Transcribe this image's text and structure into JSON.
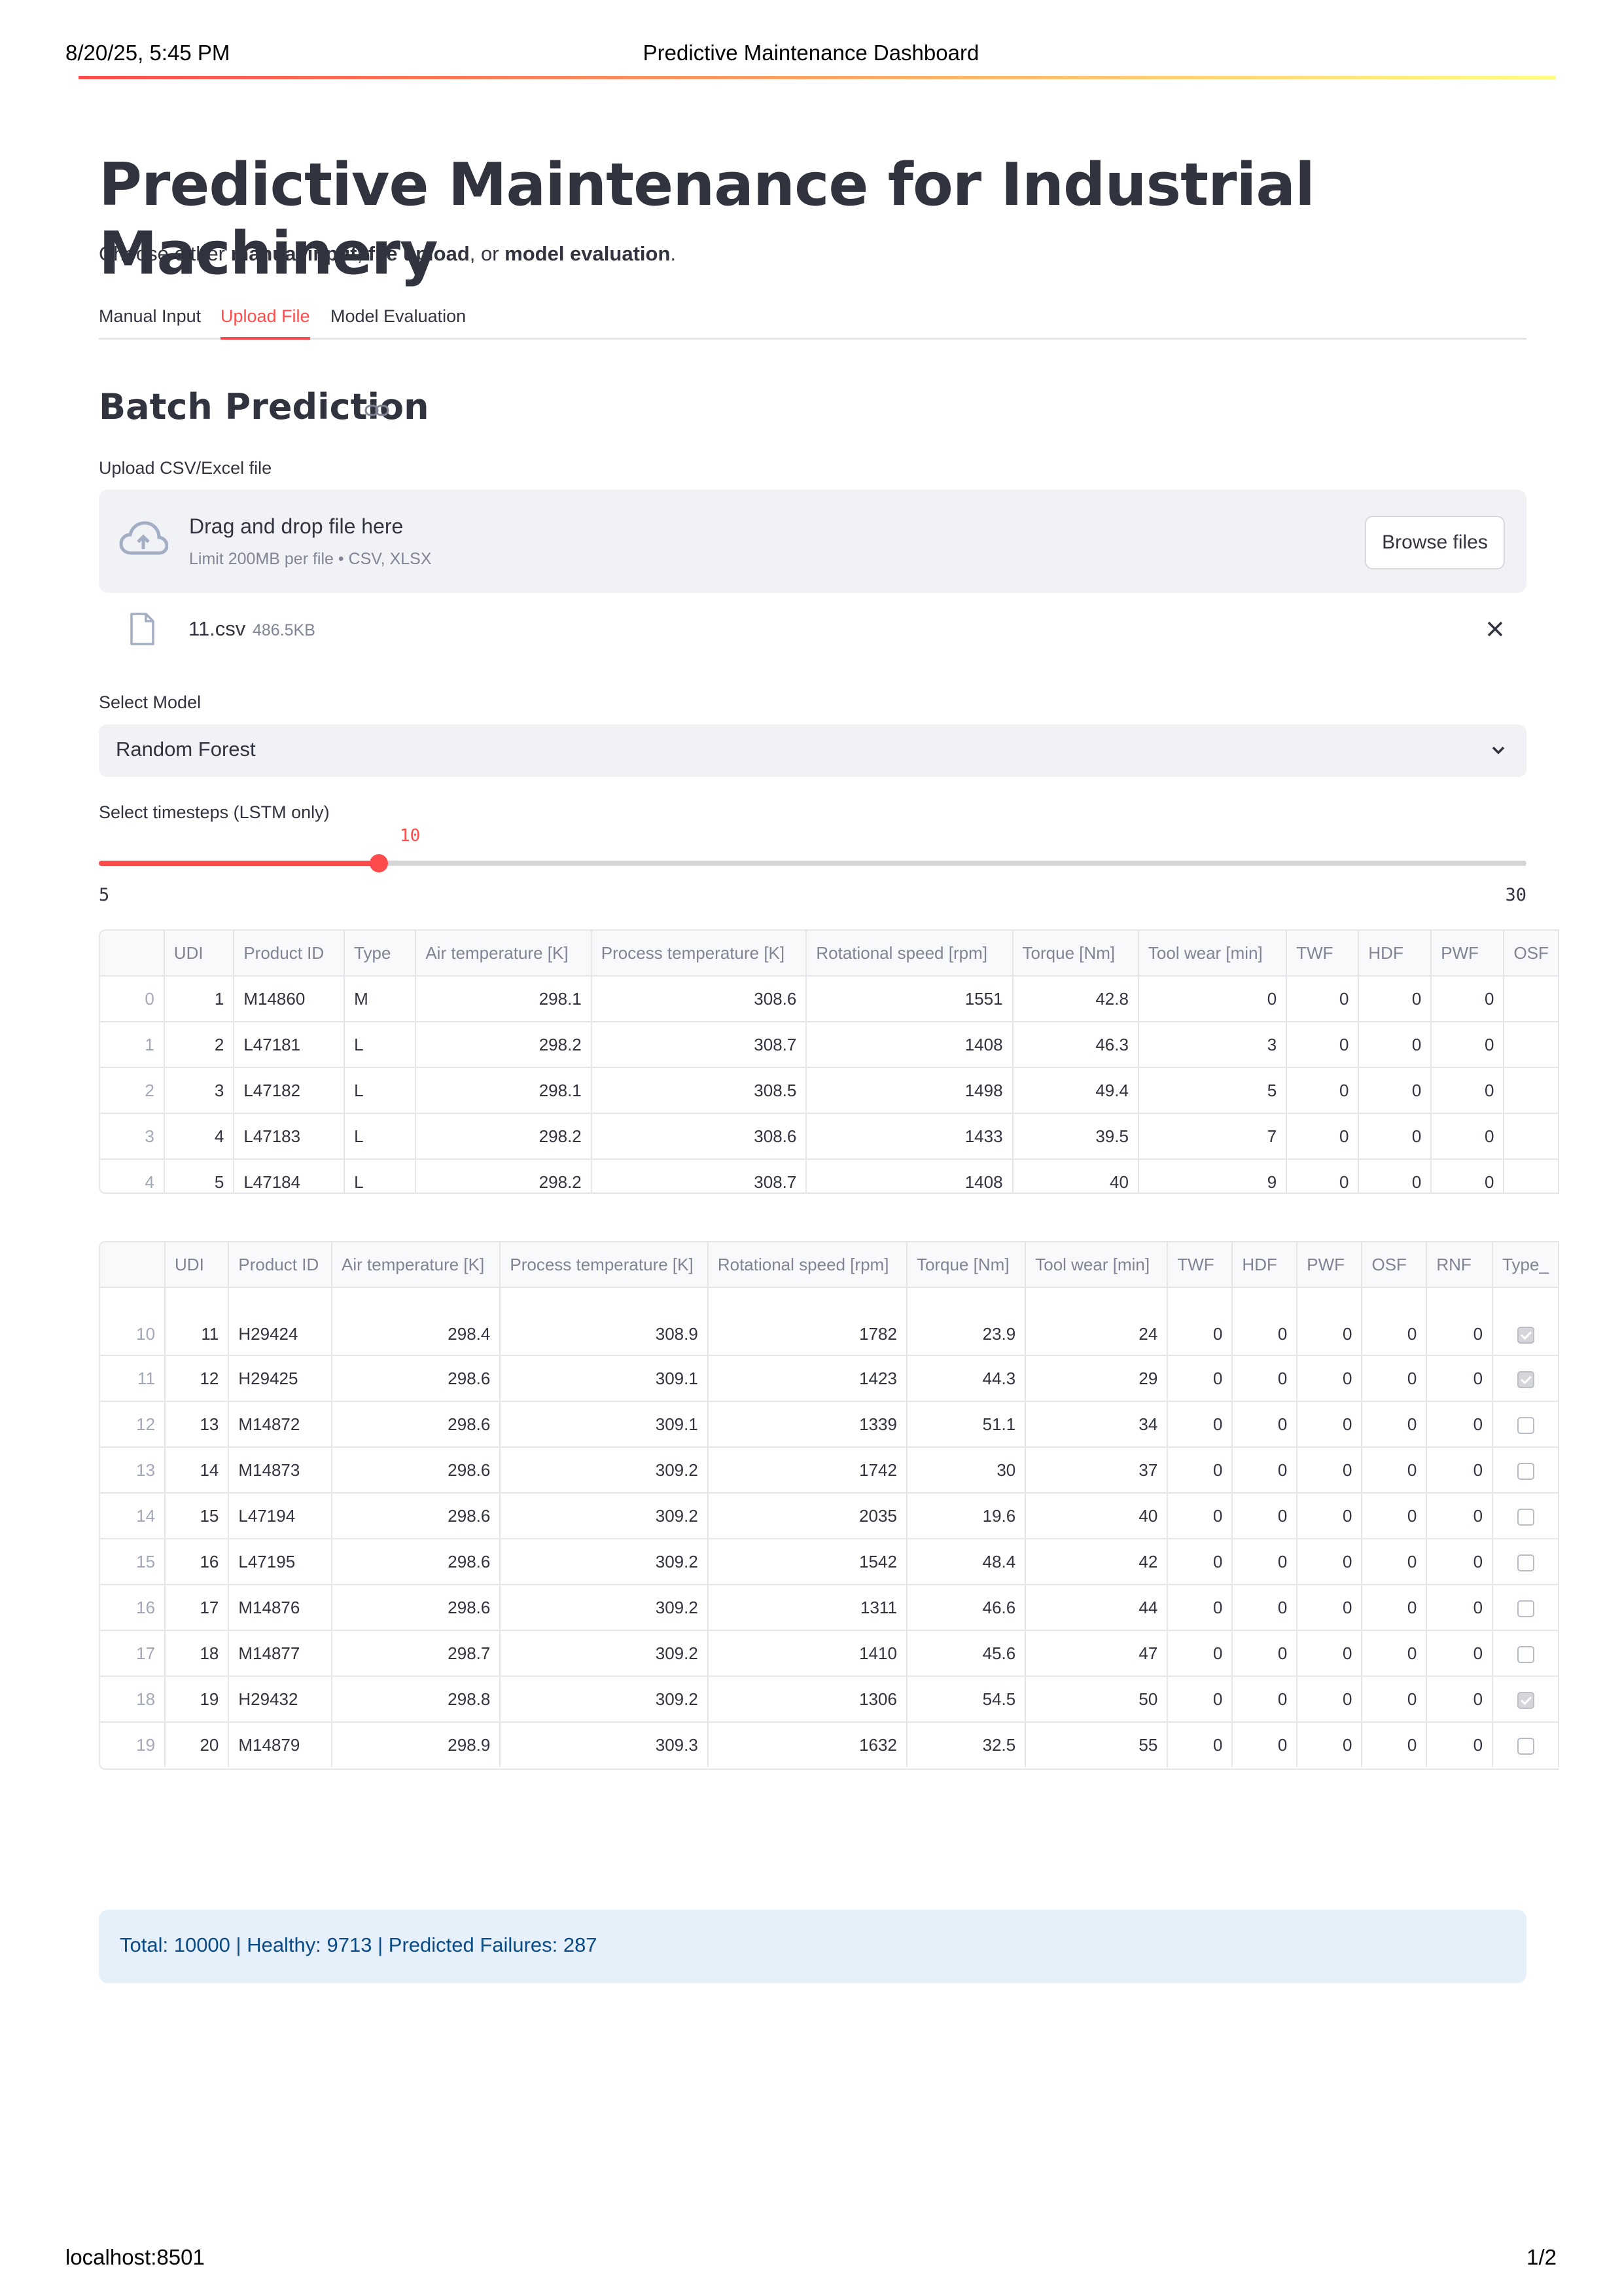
{
  "print": {
    "date": "8/20/25, 5:45 PM",
    "title": "Predictive Maintenance Dashboard",
    "url": "localhost:8501",
    "page": "1/2"
  },
  "app": {
    "title": "Predictive Maintenance for Industrial Machinery",
    "subtitle_parts": [
      "Choose either ",
      "manual input",
      ", ",
      "file upload",
      ", or ",
      "model evaluation",
      "."
    ]
  },
  "tabs": [
    {
      "label": "Manual Input",
      "active": false
    },
    {
      "label": "Upload File",
      "active": true
    },
    {
      "label": "Model Evaluation",
      "active": false
    }
  ],
  "section": {
    "title": "Batch Prediction",
    "link_icon": "link-icon"
  },
  "upload": {
    "label": "Upload CSV/Excel file",
    "drop_title": "Drag and drop file here",
    "drop_sub": "Limit 200MB per file • CSV, XLSX",
    "browse_label": "Browse files",
    "file_name": "11.csv",
    "file_size": "486.5KB"
  },
  "model_select": {
    "label": "Select Model",
    "value": "Random Forest"
  },
  "slider": {
    "label": "Select timesteps (LSTM only)",
    "value": 10,
    "value_text": "10",
    "min": 5,
    "max": 30,
    "min_text": "5",
    "max_text": "30"
  },
  "table1": {
    "columns": [
      "",
      "UDI",
      "Product ID",
      "Type",
      "Air temperature [K]",
      "Process temperature [K]",
      "Rotational speed [rpm]",
      "Torque [Nm]",
      "Tool wear [min]",
      "TWF",
      "HDF",
      "PWF",
      "OSF"
    ],
    "rows": [
      [
        "0",
        "1",
        "M14860",
        "M",
        "298.1",
        "308.6",
        "1551",
        "42.8",
        "0",
        "0",
        "0",
        "0",
        ""
      ],
      [
        "1",
        "2",
        "L47181",
        "L",
        "298.2",
        "308.7",
        "1408",
        "46.3",
        "3",
        "0",
        "0",
        "0",
        ""
      ],
      [
        "2",
        "3",
        "L47182",
        "L",
        "298.1",
        "308.5",
        "1498",
        "49.4",
        "5",
        "0",
        "0",
        "0",
        ""
      ],
      [
        "3",
        "4",
        "L47183",
        "L",
        "298.2",
        "308.6",
        "1433",
        "39.5",
        "7",
        "0",
        "0",
        "0",
        ""
      ],
      [
        "4",
        "5",
        "L47184",
        "L",
        "298.2",
        "308.7",
        "1408",
        "40",
        "9",
        "0",
        "0",
        "0",
        ""
      ]
    ]
  },
  "table2": {
    "columns": [
      "",
      "UDI",
      "Product ID",
      "Air temperature [K]",
      "Process temperature [K]",
      "Rotational speed [rpm]",
      "Torque [Nm]",
      "Tool wear [min]",
      "TWF",
      "HDF",
      "PWF",
      "OSF",
      "RNF",
      "Type_"
    ],
    "rows": [
      {
        "cells": [
          "10",
          "11",
          "H29424",
          "298.4",
          "308.9",
          "1782",
          "23.9",
          "24",
          "0",
          "0",
          "0",
          "0",
          "0"
        ],
        "checked": true
      },
      {
        "cells": [
          "11",
          "12",
          "H29425",
          "298.6",
          "309.1",
          "1423",
          "44.3",
          "29",
          "0",
          "0",
          "0",
          "0",
          "0"
        ],
        "checked": true
      },
      {
        "cells": [
          "12",
          "13",
          "M14872",
          "298.6",
          "309.1",
          "1339",
          "51.1",
          "34",
          "0",
          "0",
          "0",
          "0",
          "0"
        ],
        "checked": false
      },
      {
        "cells": [
          "13",
          "14",
          "M14873",
          "298.6",
          "309.2",
          "1742",
          "30",
          "37",
          "0",
          "0",
          "0",
          "0",
          "0"
        ],
        "checked": false
      },
      {
        "cells": [
          "14",
          "15",
          "L47194",
          "298.6",
          "309.2",
          "2035",
          "19.6",
          "40",
          "0",
          "0",
          "0",
          "0",
          "0"
        ],
        "checked": false
      },
      {
        "cells": [
          "15",
          "16",
          "L47195",
          "298.6",
          "309.2",
          "1542",
          "48.4",
          "42",
          "0",
          "0",
          "0",
          "0",
          "0"
        ],
        "checked": false
      },
      {
        "cells": [
          "16",
          "17",
          "M14876",
          "298.6",
          "309.2",
          "1311",
          "46.6",
          "44",
          "0",
          "0",
          "0",
          "0",
          "0"
        ],
        "checked": false
      },
      {
        "cells": [
          "17",
          "18",
          "M14877",
          "298.7",
          "309.2",
          "1410",
          "45.6",
          "47",
          "0",
          "0",
          "0",
          "0",
          "0"
        ],
        "checked": false
      },
      {
        "cells": [
          "18",
          "19",
          "H29432",
          "298.8",
          "309.2",
          "1306",
          "54.5",
          "50",
          "0",
          "0",
          "0",
          "0",
          "0"
        ],
        "checked": true
      },
      {
        "cells": [
          "19",
          "20",
          "M14879",
          "298.9",
          "309.3",
          "1632",
          "32.5",
          "55",
          "0",
          "0",
          "0",
          "0",
          "0"
        ],
        "checked": false
      }
    ]
  },
  "summary": {
    "text": "Total: 10000 | Healthy: 9713 | Predicted Failures: 287"
  },
  "colors": {
    "accent": "#ff4b4b",
    "info_bg": "#e6f0fa",
    "info_text": "#0b4b85"
  }
}
